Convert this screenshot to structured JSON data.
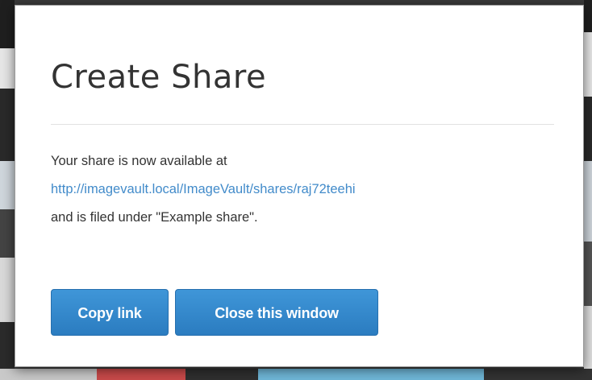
{
  "dialog": {
    "title": "Create Share",
    "message_line1": "Your share is now available at",
    "share_url": "http://imagevault.local/ImageVault/shares/raj72teehi",
    "message_line3": "and is filed under \"Example share\".",
    "copy_button": "Copy link",
    "close_button": "Close this window"
  },
  "colors": {
    "link": "#428bca",
    "button": "#2f86cc",
    "title": "#333333"
  }
}
